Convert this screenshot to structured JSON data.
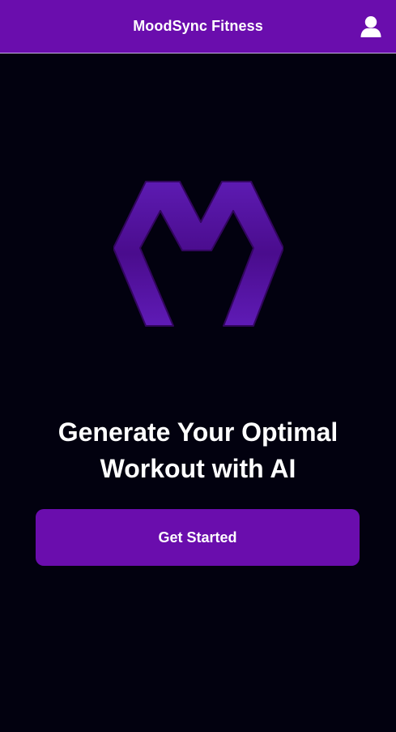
{
  "header": {
    "title": "MoodSync Fitness",
    "profile_icon": "user-profile-icon"
  },
  "logo": {
    "icon": "moodsync-m-logo",
    "color": "#4b0d91"
  },
  "hero": {
    "line1": "Generate Your Optimal",
    "line2": "Workout with AI"
  },
  "cta": {
    "label": "Get Started"
  },
  "colors": {
    "accent": "#6a0dad",
    "background": "#02010f",
    "text": "#ffffff"
  }
}
